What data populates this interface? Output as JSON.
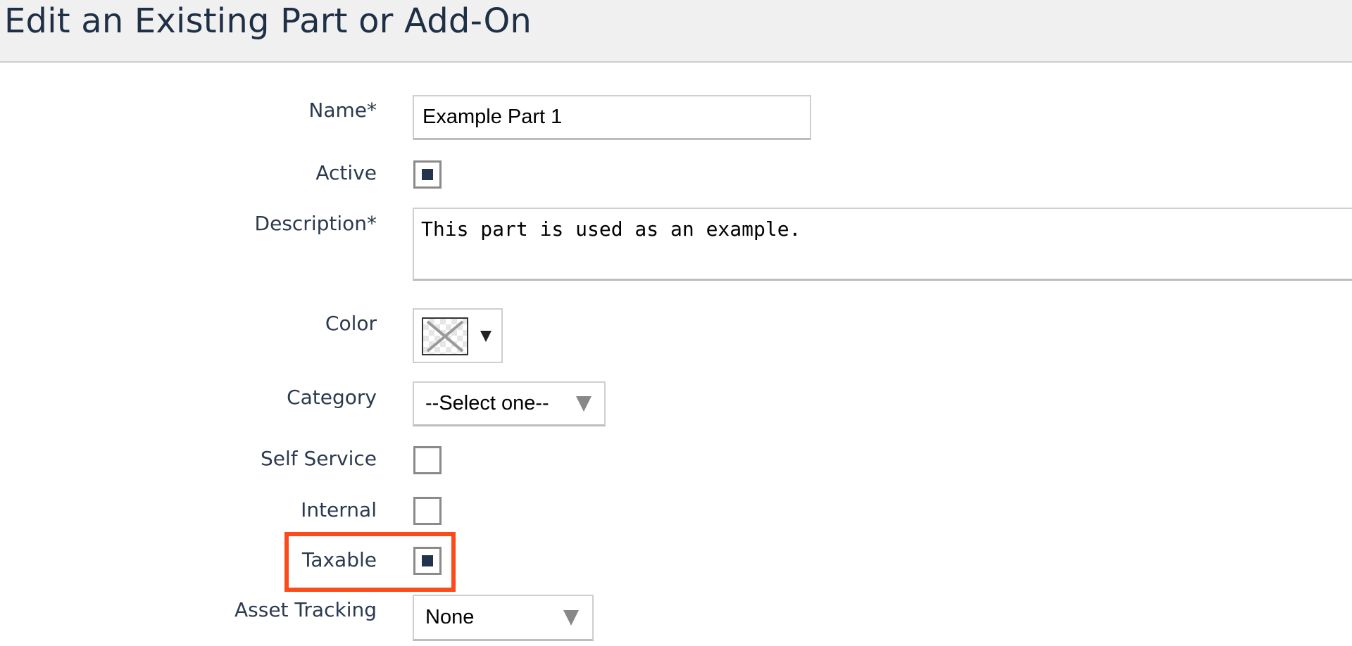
{
  "header": {
    "title": "Edit an Existing Part or Add-On"
  },
  "form": {
    "name": {
      "label": "Name*",
      "value": "Example Part 1"
    },
    "active": {
      "label": "Active",
      "checked": true
    },
    "description": {
      "label": "Description*",
      "value": "This part is used as an example."
    },
    "color": {
      "label": "Color",
      "icon": "no-color-swatch-icon",
      "caret": "▼"
    },
    "category": {
      "label": "Category",
      "selected": "--Select one--"
    },
    "self_service": {
      "label": "Self Service",
      "checked": false
    },
    "internal": {
      "label": "Internal",
      "checked": false
    },
    "taxable": {
      "label": "Taxable",
      "checked": true,
      "highlight_color": "#fd4a1a"
    },
    "asset_tracking": {
      "label": "Asset Tracking",
      "selected": "None"
    }
  },
  "colors": {
    "title_text": "#1f2f45",
    "checkbox_fill": "#22344d",
    "header_bg": "#f0f0f0"
  }
}
